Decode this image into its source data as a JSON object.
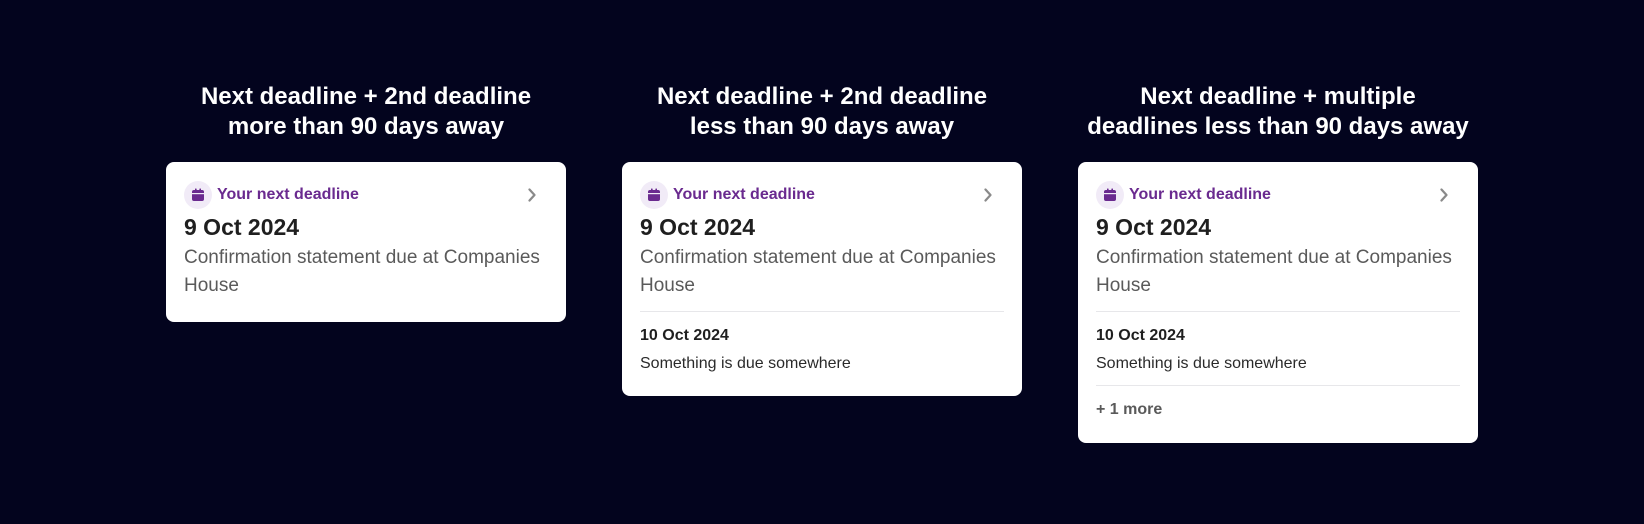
{
  "columns": [
    {
      "title_line1": "Next deadline + 2nd deadline",
      "title_line2": "more than 90 days away",
      "card": {
        "header_label": "Your next deadline",
        "icon": "calendar-icon",
        "chevron_icon": "chevron-right-icon",
        "date": "9 Oct 2024",
        "description": "Confirmation statement due at Companies House"
      }
    },
    {
      "title_line1": "Next deadline + 2nd deadline",
      "title_line2": "less than 90 days away",
      "card": {
        "header_label": "Your next deadline",
        "icon": "calendar-icon",
        "chevron_icon": "chevron-right-icon",
        "date": "9 Oct 2024",
        "description": "Confirmation statement due at Companies House",
        "second": {
          "date": "10 Oct 2024",
          "description": "Something is due somewhere"
        }
      }
    },
    {
      "title_line1": "Next deadline + multiple",
      "title_line2": "deadlines less than 90 days away",
      "card": {
        "header_label": "Your next deadline",
        "icon": "calendar-icon",
        "chevron_icon": "chevron-right-icon",
        "date": "9 Oct 2024",
        "description": "Confirmation statement due at Companies House",
        "second": {
          "date": "10 Oct 2024",
          "description": "Something is due somewhere"
        },
        "more_label": "+ 1 more"
      }
    }
  ],
  "colors": {
    "background": "#03041e",
    "card": "#ffffff",
    "accent_purple": "#6a2a8f",
    "icon_bg": "#f1ebf7",
    "text_dark": "#1f1f1f",
    "text_muted": "#5a5a5a"
  }
}
